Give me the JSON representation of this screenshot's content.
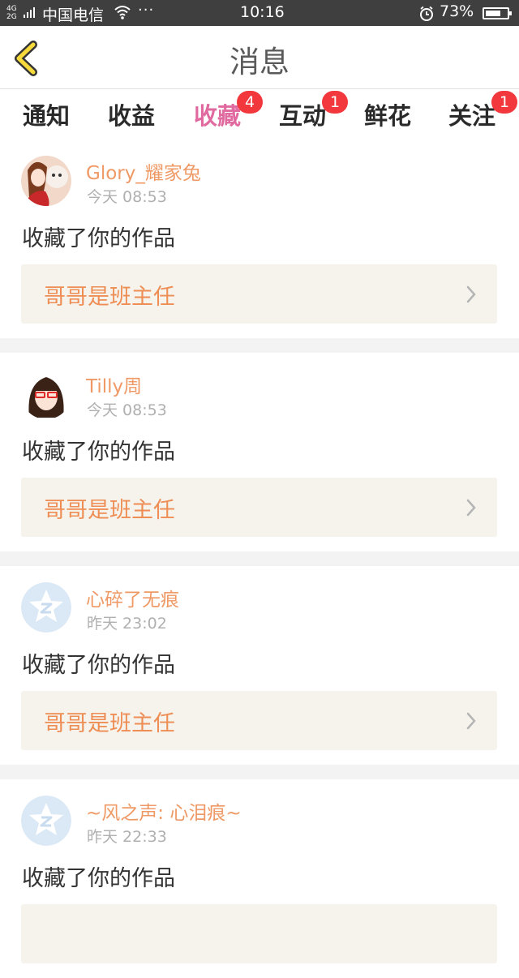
{
  "status_bar": {
    "network": "4G",
    "network2": "2G",
    "carrier": "中国电信",
    "more": "···",
    "time": "10:16",
    "battery_percent": "73%",
    "battery_level": 0.73
  },
  "header": {
    "title": "消息",
    "back_icon": "chevron-left-icon"
  },
  "tabs": [
    {
      "label": "通知",
      "badge": null,
      "active": false
    },
    {
      "label": "收益",
      "badge": null,
      "active": false
    },
    {
      "label": "收藏",
      "badge": "4",
      "active": true
    },
    {
      "label": "互动",
      "badge": "1",
      "active": false
    },
    {
      "label": "鲜花",
      "badge": null,
      "active": false
    },
    {
      "label": "关注",
      "badge": "1",
      "active": false
    }
  ],
  "colors": {
    "accent": "#e06aa0",
    "username": "#ef9a66",
    "badge": "#f2383c",
    "link_bg": "#f5f3ec"
  },
  "messages": [
    {
      "username": "Glory_耀家兔",
      "time": "今天 08:53",
      "action": "收藏了你的作品",
      "work_title": "哥哥是班主任",
      "avatar": "photo-avatar"
    },
    {
      "username": "Tilly周",
      "time": "今天 08:53",
      "action": "收藏了你的作品",
      "work_title": "哥哥是班主任",
      "avatar": "cartoon-girl-avatar"
    },
    {
      "username": "心碎了无痕",
      "time": "昨天 23:02",
      "action": "收藏了你的作品",
      "work_title": "哥哥是班主任",
      "avatar": "default-avatar"
    },
    {
      "username": "~风之声: 心泪痕~",
      "time": "昨天 22:33",
      "action": "收藏了你的作品",
      "work_title": "",
      "avatar": "default-avatar"
    }
  ]
}
